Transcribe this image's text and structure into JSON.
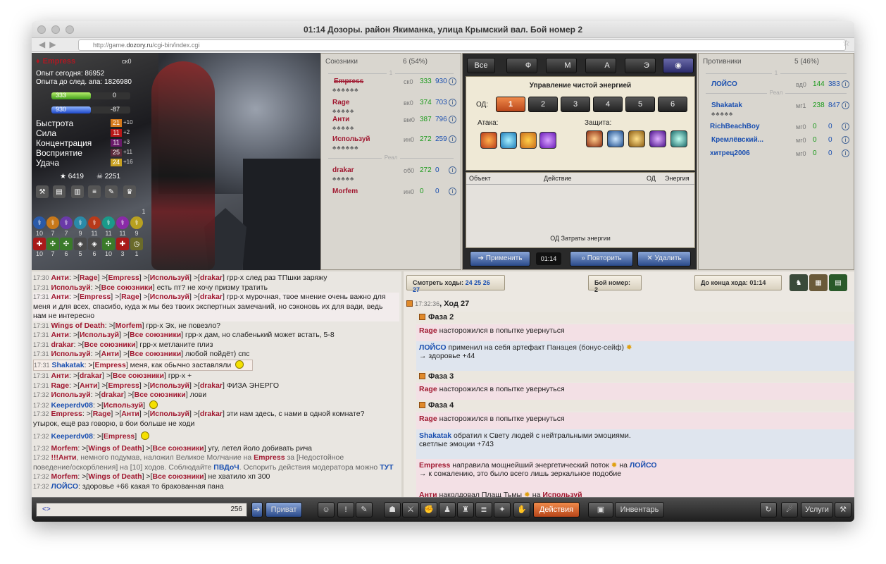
{
  "window": {
    "title": "01:14 Дозоры. район Якиманка, улица Крымский вал. Бой номер 2",
    "url_pre": "http://game.",
    "url_domain": "dozory.ru",
    "url_post": "/cgi-bin/index.cgi"
  },
  "hero": {
    "name": "Empress",
    "sk": "ск0",
    "exp_today": "Опыт сегодня: 86952",
    "exp_next": "Опыта до след. апа: 1826980",
    "hp": "333",
    "hp2": "0",
    "mp": "930",
    "mp2": "-87",
    "attrs": [
      {
        "label": "Быстрота",
        "val": "21",
        "bonus": "+10"
      },
      {
        "label": "Сила",
        "val": "11",
        "bonus": "+2"
      },
      {
        "label": "Концентрация",
        "val": "11",
        "bonus": "+3"
      },
      {
        "label": "Восприятие",
        "val": "25",
        "bonus": "+11"
      },
      {
        "label": "Удача",
        "val": "24",
        "bonus": "+16"
      }
    ],
    "wins": "6419",
    "losses": "2251",
    "res_row1": [
      "10",
      "7",
      "7",
      "9",
      "11",
      "11",
      "11",
      "9"
    ],
    "res_row2": [
      "10",
      "7",
      "6",
      "5",
      "6",
      "10",
      "3",
      "1"
    ],
    "res_top": "1"
  },
  "allies": {
    "title": "Союзники",
    "count": "6 (54%)",
    "sep_top": "1",
    "sep_real": "Реал",
    "rows": [
      {
        "name": "Empress",
        "rank": "ск0",
        "hp": "333",
        "mp": "930"
      },
      {
        "name": "Rage",
        "rank": "вк0",
        "hp": "374",
        "mp": "703"
      },
      {
        "name": "Анти",
        "rank": "вм0",
        "hp": "387",
        "mp": "796"
      },
      {
        "name": "Используй",
        "rank": "ин0",
        "hp": "272",
        "mp": "259"
      },
      {
        "name": "drakar",
        "rank": "об0",
        "hp": "272",
        "mp": "0"
      },
      {
        "name": "Morfem",
        "rank": "ин0",
        "hp": "0",
        "mp": "0"
      }
    ]
  },
  "enemies": {
    "title": "Противники",
    "count": "5 (46%)",
    "sep_top": "1",
    "sep_real": "Реал",
    "rows": [
      {
        "name": "ЛОЙСО",
        "rank": "вд0",
        "hp": "144",
        "mp": "383"
      },
      {
        "name": "Shakatak",
        "rank": "мг1",
        "hp": "238",
        "mp": "847"
      },
      {
        "name": "RichBeachBoy",
        "rank": "мг0",
        "hp": "0",
        "mp": "0"
      },
      {
        "name": "Кремлёвский...",
        "rank": "мг0",
        "hp": "0",
        "mp": "0"
      },
      {
        "name": "хитрец2006",
        "rank": "мг0",
        "hp": "0",
        "mp": "0"
      }
    ]
  },
  "energy": {
    "tabs": [
      "Все",
      "Ф",
      "М",
      "А",
      "Э"
    ],
    "heading": "Управление чистой энергией",
    "od_label": "ОД:",
    "od": [
      "1",
      "2",
      "3",
      "4",
      "5",
      "6"
    ],
    "attack": "Атака:",
    "defense": "Защита:",
    "table_cols": [
      "Объект",
      "Действие",
      "ОД",
      "Энергия"
    ],
    "footer": "ОД   Затраты энергии",
    "apply": "Применить",
    "timer": "01:14",
    "repeat": "Повторить",
    "delete": "Удалить"
  },
  "log": {
    "view_moves_label": "Смотреть ходы:",
    "moves": [
      "24",
      "25",
      "26",
      "27"
    ],
    "battle_no": "Бой номер: 2",
    "turn_end": "До конца хода: 01:14",
    "turn_time": "17:32:36",
    "turn_title": ", Ход 27",
    "phase2": "Фаза 2",
    "phase3": "Фаза 3",
    "phase4": "Фаза 4",
    "e1a": "Rage",
    "e1b": " насторожился в попытке увернуться",
    "e2a": "ЛОЙСО",
    "e2b": " применил на себя артефакт ",
    "e2c": "Панацея (бонус-сейф)",
    "e2d": "→ здоровье +44",
    "e3a": "Rage",
    "e3b": " насторожился в попытке увернуться",
    "e4a": "Rage",
    "e4b": " насторожился в попытке увернуться",
    "e5a": "Shakatak",
    "e5b": " обратил к Свету людей с нейтральными эмоциями.",
    "e5c": "светлые эмоции +743",
    "e6a": "Empress",
    "e6b": " направила мощнейший энергетический поток ",
    "e6c": " на ",
    "e6d": "ЛОЙСО",
    "e6e": "→ к сожалению, это было всего лишь зеркальное подобие",
    "e7a": "Анти",
    "e7b": " наколдовал Плащ Тьмы ",
    "e7c": " на ",
    "e7d": "Используй"
  },
  "chat": {
    "lines": [
      {
        "t": "17:30",
        "html": "<span class='u'>Анти</span>: &gt;[<span class='b'>Rage</span>] &gt;[<span class='b'>Empress</span>] &gt;[<span class='b'>Используй</span>] &gt;[<span class='b'>drakar</span>]  грр-х след раз ТПшки заряжу"
      },
      {
        "t": "17:31",
        "html": "<span class='u'>Используй</span>: &gt;[<span class='b'>Все союзники</span>]  есть пт? не хочу призму тратить"
      },
      {
        "t": "17:31",
        "html": "<span class='u'>Анти</span>: &gt;[<span class='b'>Empress</span>] &gt;[<span class='b'>Rage</span>] &gt;[<span class='b'>Используй</span>] &gt;[<span class='b'>drakar</span>]  грр-х мурочная, твое мнение очень важно для"
      },
      {
        "t": "",
        "html": "меня и для всех, спасибо, куда ж мы без твоих экспертных замечаний, но сэконовь их для вади, ведь"
      },
      {
        "t": "",
        "html": "нам не интересно"
      },
      {
        "t": "17:31",
        "html": "<span class='u'>Wings of Death</span>: &gt;[<span class='b'>Morfem</span>]  грр-х Эх, не повезло?"
      },
      {
        "t": "17:31",
        "html": "<span class='u'>Анти</span>: &gt;[<span class='b'>Используй</span>] &gt;[<span class='b'>Все союзники</span>]  грр-х дам, но слабенький может встать, 5-8"
      },
      {
        "t": "17:31",
        "html": "<span class='u'>drakar</span>: &gt;[<span class='b'>Все союзники</span>]  грр-х метланите плиз"
      },
      {
        "t": "17:31",
        "html": "<span class='u'>Используй</span>: &gt;[<span class='b'>Анти</span>] &gt;[<span class='b'>Все союзники</span>]  любой пойдёт) спс"
      },
      {
        "t": "17:31",
        "html": "<span class='bl'>Shakatak</span>: &gt;[<span class='b'>Empress</span>]  меня, как обычно заставляли"
      },
      {
        "t": "17:31",
        "html": "<span class='u'>Анти</span>: &gt;[<span class='b'>drakar</span>] &gt;[<span class='b'>Все союзники</span>]  грр-х +"
      },
      {
        "t": "17:31",
        "html": "<span class='u'>Rage</span>: &gt;[<span class='b'>Анти</span>] &gt;[<span class='b'>Empress</span>] &gt;[<span class='b'>Используй</span>] &gt;[<span class='b'>drakar</span>]  ФИЗА ЭНЕРГО"
      },
      {
        "t": "17:32",
        "html": "<span class='u'>Используй</span>: &gt;[<span class='b'>drakar</span>] &gt;[<span class='b'>Все союзники</span>]  лови"
      },
      {
        "t": "17:32",
        "html": "<span class='bl'>Keeperdv08</span>: &gt;[<span class='b'>Используй</span>]"
      },
      {
        "t": "17:32",
        "html": "<span class='u'>Empress</span>: &gt;[<span class='b'>Rage</span>] &gt;[<span class='b'>Анти</span>] &gt;[<span class='b'>Используй</span>] &gt;[<span class='b'>drakar</span>]  эти нам здесь, с нами в одной комнате?"
      },
      {
        "t": "",
        "html": "утырок, ещё раз говорю, в бои больше не ходи"
      },
      {
        "t": "17:32",
        "html": "<span class='bl'>Keeperdv08</span>: &gt;[<span class='b'>Empress</span>]"
      },
      {
        "t": "17:32",
        "html": "<span class='u'>Morfem</span>: &gt;[<span class='b'>Wings of Death</span>] &gt;[<span class='b'>Все союзники</span>]  угу, летел йоло добивать рича"
      },
      {
        "t": "17:32",
        "html": "<span class='b'>!!!Анти</span><span class='gr'>, немного подумав, наложил Великое Молчание на </span><span class='b'>Empress</span><span class='gr'> за [Недостойное</span>"
      },
      {
        "t": "",
        "html": "<span class='gr'>поведение/оскорбления] на [10] ходов. Соблюдайте </span><span class='bl'>ПВДоЧ</span><span class='gr'>. Оспорить действия модератора можно </span><span class='bl'>ТУТ</span>"
      },
      {
        "t": "17:32",
        "html": "<span class='u'>Morfem</span>: &gt;[<span class='b'>Wings of Death</span>] &gt;[<span class='b'>Все союзники</span>]  не хватило хп 300"
      },
      {
        "t": "17:32",
        "html": "<span class='bl'>ЛОЙСО</span>:  здоровье +66 какая то бракованная пана"
      }
    ]
  },
  "bottom": {
    "input_prefix": "<>",
    "input_count": "256",
    "private": "Приват",
    "actions": "Действия",
    "inventory": "Инвентарь",
    "services": "Услуги"
  }
}
